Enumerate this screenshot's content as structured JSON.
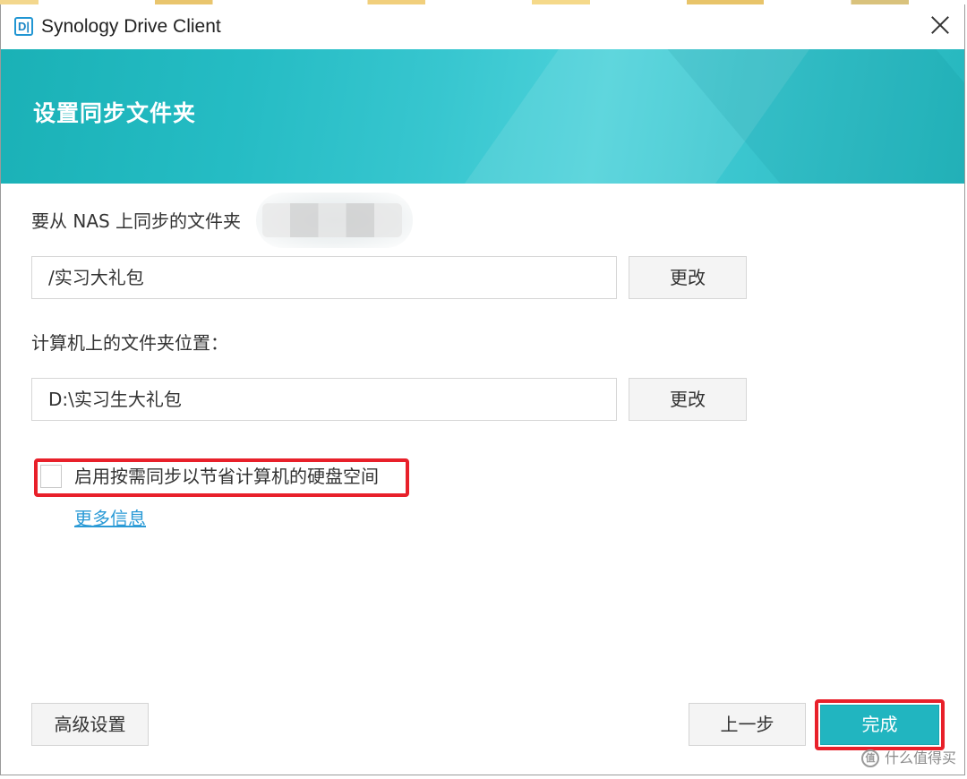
{
  "window": {
    "title": "Synology Drive Client",
    "logo_text": "D|"
  },
  "banner": {
    "title": "设置同步文件夹"
  },
  "nas_folder": {
    "label": "要从 NAS 上同步的文件夹",
    "value": "/实习大礼包",
    "change_label": "更改"
  },
  "local_folder": {
    "label": "计算机上的文件夹位置：",
    "value": "D:\\实习生大礼包",
    "change_label": "更改"
  },
  "on_demand": {
    "label": "启用按需同步以节省计算机的硬盘空间",
    "checked": false,
    "more_info": "更多信息"
  },
  "footer": {
    "advanced_label": "高级设置",
    "prev_label": "上一步",
    "finish_label": "完成"
  },
  "watermark": {
    "logo": "值",
    "text": "什么值得买"
  },
  "colors": {
    "accent": "#21b5c0",
    "highlight": "#e8202a",
    "link": "#2a9ad6"
  }
}
